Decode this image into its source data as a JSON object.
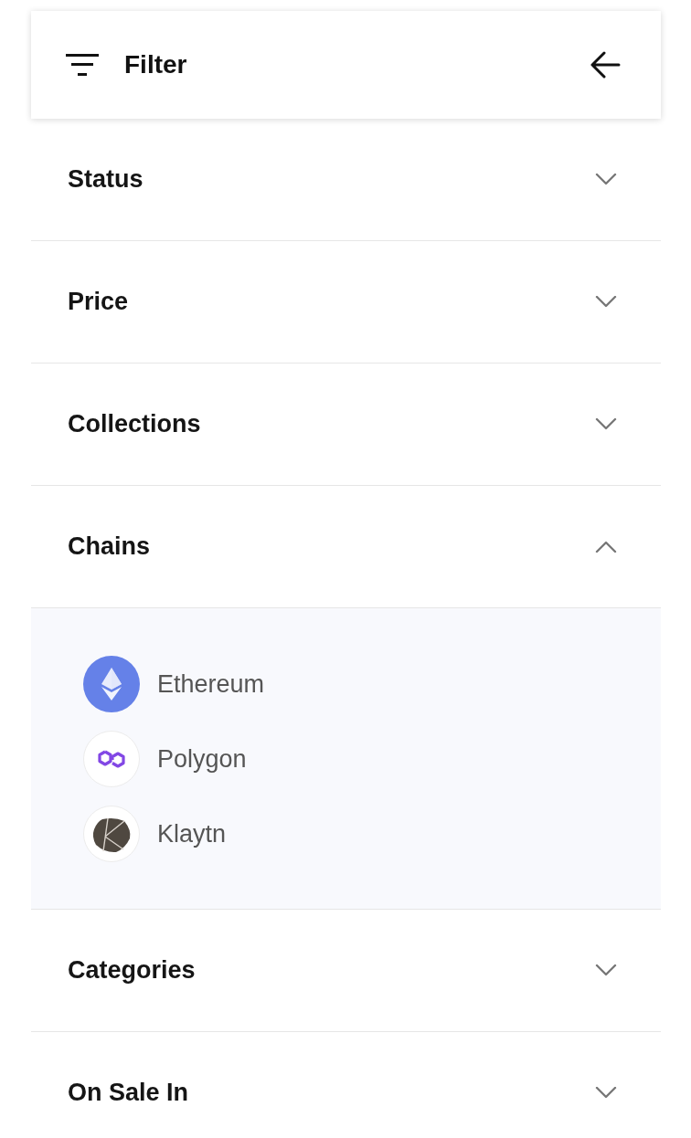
{
  "header": {
    "title": "Filter"
  },
  "sections": [
    {
      "label": "Status",
      "expanded": false
    },
    {
      "label": "Price",
      "expanded": false
    },
    {
      "label": "Collections",
      "expanded": false
    },
    {
      "label": "Chains",
      "expanded": true,
      "options": [
        {
          "label": "Ethereum",
          "kind": "ethereum"
        },
        {
          "label": "Polygon",
          "kind": "polygon"
        },
        {
          "label": "Klaytn",
          "kind": "klaytn"
        }
      ]
    },
    {
      "label": "Categories",
      "expanded": false
    },
    {
      "label": "On Sale In",
      "expanded": false
    }
  ]
}
